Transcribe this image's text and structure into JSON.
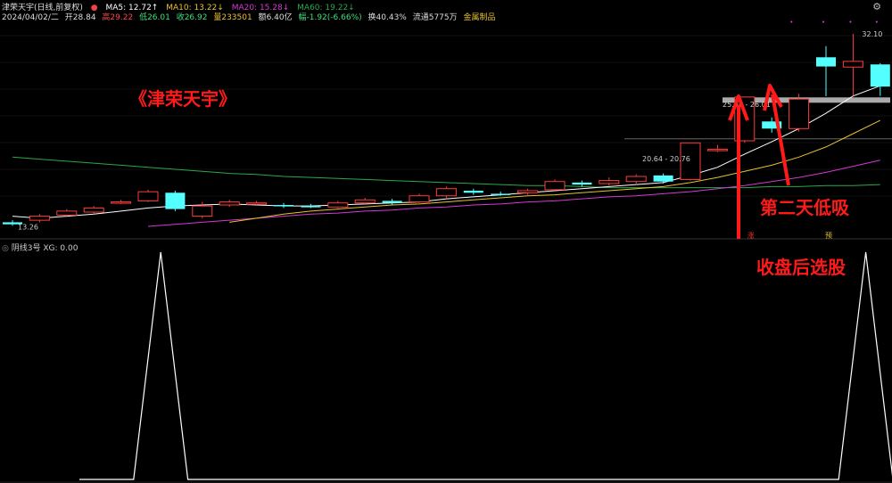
{
  "header": {
    "stock_name": "津荣天宇(日线,前复权)",
    "ma5": "MA5: 12.72↑",
    "ma10": "MA10: 13.22↓",
    "ma20": "MA20: 15.28↓",
    "ma60": "MA60: 19.22↓",
    "date": "2024/04/02/二",
    "open": "开28.84",
    "high": "高29.22",
    "low": "低26.01",
    "close": "收26.92",
    "volume": "量233501",
    "amount": "额6.40亿",
    "change": "幅-1.92(-6.66%)",
    "turnover": "换40.43%",
    "float": "流通5775万",
    "sector": "金属制品"
  },
  "indicator_header": {
    "name": "阴线3号",
    "value": "XG: 0.00"
  },
  "colors": {
    "up": "#ff3b3b",
    "down": "#54ffff",
    "ma5": "#ffffff",
    "ma10": "#e8c130",
    "ma20": "#d637d6",
    "ma60": "#2aa84a",
    "annotation": "#ff1a1a"
  },
  "annotations": {
    "title": "《津荣天宇》",
    "second_day": "第二天低吸",
    "after_close": "收盘后选股",
    "marker1": "涨",
    "marker2": "预"
  },
  "chart_data": [
    {
      "type": "candlestick",
      "title": "",
      "labels": {
        "min_label": "13.26",
        "max_label": "32.10",
        "range1": "20.64 - 20.76",
        "range2": "25.98 - 26.01"
      },
      "ylim": [
        12.5,
        33.5
      ],
      "candles": [
        {
          "o": 13.6,
          "c": 13.4,
          "h": 13.8,
          "l": 13.26
        },
        {
          "o": 13.8,
          "c": 14.2,
          "h": 14.4,
          "l": 13.6
        },
        {
          "o": 14.3,
          "c": 14.7,
          "h": 14.9,
          "l": 14.1
        },
        {
          "o": 14.6,
          "c": 15.0,
          "h": 15.2,
          "l": 14.4
        },
        {
          "o": 15.6,
          "c": 15.6,
          "h": 15.8,
          "l": 15.4
        },
        {
          "o": 15.7,
          "c": 16.6,
          "h": 16.8,
          "l": 15.6
        },
        {
          "o": 16.5,
          "c": 14.9,
          "h": 16.7,
          "l": 14.7
        },
        {
          "o": 14.2,
          "c": 15.2,
          "h": 15.6,
          "l": 14.0
        },
        {
          "o": 15.3,
          "c": 15.6,
          "h": 15.8,
          "l": 15.1
        },
        {
          "o": 15.5,
          "c": 15.5,
          "h": 15.7,
          "l": 15.3
        },
        {
          "o": 15.3,
          "c": 15.2,
          "h": 15.5,
          "l": 15.0
        },
        {
          "o": 15.2,
          "c": 15.1,
          "h": 15.4,
          "l": 15.0
        },
        {
          "o": 15.1,
          "c": 15.5,
          "h": 15.7,
          "l": 15.0
        },
        {
          "o": 15.5,
          "c": 15.8,
          "h": 16.0,
          "l": 15.3
        },
        {
          "o": 15.7,
          "c": 15.5,
          "h": 15.9,
          "l": 15.3
        },
        {
          "o": 15.6,
          "c": 16.2,
          "h": 16.4,
          "l": 15.5
        },
        {
          "o": 16.2,
          "c": 16.9,
          "h": 17.1,
          "l": 16.0
        },
        {
          "o": 16.7,
          "c": 16.5,
          "h": 16.9,
          "l": 16.3
        },
        {
          "o": 16.4,
          "c": 16.3,
          "h": 16.6,
          "l": 16.2
        },
        {
          "o": 16.5,
          "c": 16.7,
          "h": 16.9,
          "l": 16.3
        },
        {
          "o": 16.8,
          "c": 17.6,
          "h": 17.8,
          "l": 16.7
        },
        {
          "o": 17.5,
          "c": 17.3,
          "h": 17.7,
          "l": 17.1
        },
        {
          "o": 17.4,
          "c": 17.7,
          "h": 18.0,
          "l": 17.2
        },
        {
          "o": 17.6,
          "c": 18.1,
          "h": 18.3,
          "l": 17.4
        },
        {
          "o": 18.2,
          "c": 17.6,
          "h": 18.4,
          "l": 17.4
        },
        {
          "o": 17.8,
          "c": 21.4,
          "h": 21.4,
          "l": 17.7
        },
        {
          "o": 20.64,
          "c": 20.76,
          "h": 21.2,
          "l": 20.5
        },
        {
          "o": 21.6,
          "c": 25.9,
          "h": 25.9,
          "l": 21.4
        },
        {
          "o": 23.5,
          "c": 22.8,
          "h": 23.9,
          "l": 22.4
        },
        {
          "o": 22.8,
          "c": 25.7,
          "h": 26.2,
          "l": 22.5
        },
        {
          "o": 29.8,
          "c": 28.9,
          "h": 30.9,
          "l": 25.98
        },
        {
          "o": 28.84,
          "c": 29.4,
          "h": 32.1,
          "l": 26.01
        },
        {
          "o": 29.1,
          "c": 26.92,
          "h": 29.22,
          "l": 26.01
        }
      ],
      "ma5": [
        14.2,
        14.0,
        14.2,
        14.4,
        14.7,
        15.0,
        15.2,
        15.3,
        15.4,
        15.3,
        15.2,
        15.2,
        15.3,
        15.4,
        15.5,
        15.6,
        15.9,
        16.1,
        16.3,
        16.5,
        16.7,
        16.9,
        17.1,
        17.3,
        17.5,
        18.2,
        19.0,
        20.3,
        21.5,
        22.8,
        24.3,
        26.0,
        27.0
      ],
      "ma10": [
        null,
        null,
        null,
        null,
        null,
        null,
        null,
        null,
        13.6,
        14.0,
        14.4,
        14.7,
        14.9,
        15.1,
        15.3,
        15.4,
        15.6,
        15.8,
        16.0,
        16.2,
        16.3,
        16.5,
        16.7,
        16.9,
        17.1,
        17.5,
        18.0,
        18.6,
        19.2,
        20.0,
        21.0,
        22.3,
        23.6
      ],
      "ma20": [
        null,
        null,
        null,
        null,
        null,
        13.2,
        13.4,
        13.6,
        13.8,
        14.0,
        14.2,
        14.4,
        14.5,
        14.7,
        14.8,
        15.0,
        15.1,
        15.3,
        15.4,
        15.6,
        15.7,
        15.9,
        16.1,
        16.2,
        16.4,
        16.6,
        16.9,
        17.2,
        17.6,
        18.0,
        18.5,
        19.1,
        19.7
      ],
      "ma60": [
        20.0,
        19.8,
        19.6,
        19.4,
        19.2,
        19.0,
        18.8,
        18.6,
        18.4,
        18.3,
        18.1,
        18.0,
        17.9,
        17.8,
        17.7,
        17.6,
        17.5,
        17.4,
        17.3,
        17.2,
        17.2,
        17.1,
        17.0,
        17.0,
        17.0,
        17.0,
        17.0,
        17.0,
        17.1,
        17.1,
        17.2,
        17.2,
        17.3
      ],
      "levels": [
        25.6,
        21.8
      ]
    },
    {
      "type": "line",
      "title": "",
      "series": [
        {
          "values": [
            0,
            0,
            0,
            1,
            0,
            0,
            0,
            0,
            0,
            0,
            0,
            0,
            0,
            0,
            0,
            0,
            0,
            0,
            0,
            0,
            0,
            0,
            0,
            0,
            0,
            0,
            0,
            0,
            0,
            1,
            0,
            0
          ]
        }
      ],
      "ylim": [
        0,
        1
      ]
    }
  ]
}
